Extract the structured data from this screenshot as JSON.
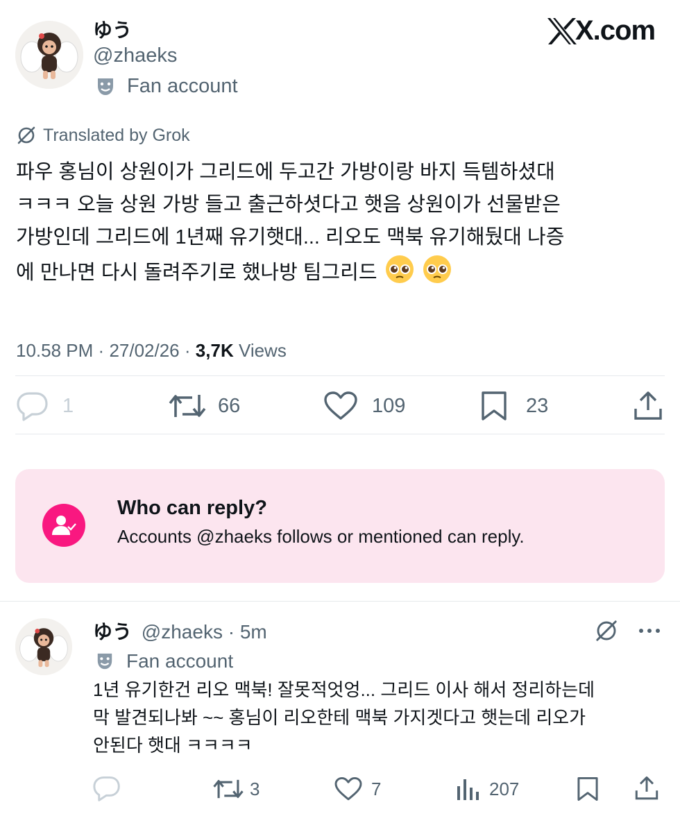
{
  "post": {
    "display_name": "ゆう",
    "handle": "@zhaeks",
    "label": "Fan account",
    "brand": "X.com",
    "translated_by": "Translated by Grok",
    "text_lines": [
      "파우 홍님이 상원이가 그리드에 두고간 가방이랑 바지 득템하셨대",
      "ㅋㅋㅋ 오늘 상원 가방 들고 출근하셧다고 햇음 상원이가 선물받은",
      "가방인데 그리드에 1년째 유기햇대... 리오도 맥북 유기해뒀대 나증",
      "에 만나면 다시 돌려주기로 했나방 팀그리드"
    ],
    "time": "10.58 PM",
    "date": "27/02/26",
    "views_count": "3,7K",
    "views_label": "Views",
    "sep": "·",
    "stats": {
      "replies": "1",
      "reposts": "66",
      "likes": "109",
      "bookmarks": "23"
    }
  },
  "reply_restriction": {
    "title": "Who can reply?",
    "description": "Accounts @zhaeks follows or mentioned can reply.",
    "accent": "#f91880",
    "background": "#fce5ef"
  },
  "reply": {
    "display_name": "ゆう",
    "handle": "@zhaeks",
    "sep": "·",
    "time": "5m",
    "label": "Fan account",
    "text_lines": [
      "1년 유기한건 리오 맥북! 잘못적엇엉... 그리드 이사 해서 정리하는데",
      "막 발견되나봐 ~~ 홍님이 리오한테 맥북 가지겟다고 햇는데 리오가",
      "안된다 햇대 ㅋㅋㅋㅋ"
    ],
    "stats": {
      "replies": "",
      "reposts": "3",
      "likes": "7",
      "views": "207"
    }
  },
  "icons": {
    "label_icon": "theater-mask-icon",
    "translate_icon": "grok-icon",
    "brand_icon": "x-logo",
    "emoji": "pleading-face-emoji"
  }
}
